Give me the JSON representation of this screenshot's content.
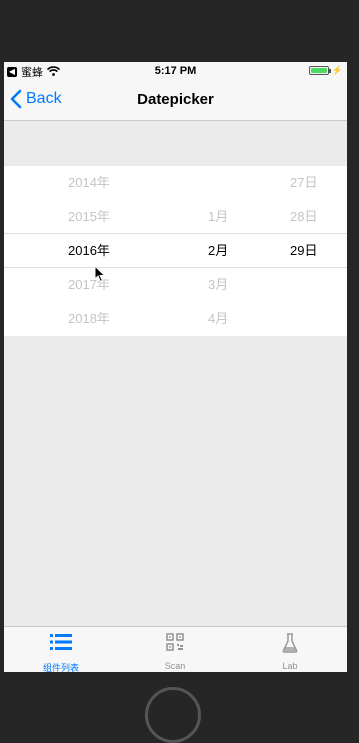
{
  "status_bar": {
    "carrier": "蜜蜂",
    "time": "5:17 PM",
    "battery_level": 1.0
  },
  "nav": {
    "back_label": "Back",
    "title": "Datepicker"
  },
  "picker": {
    "years": [
      "2014年",
      "2015年",
      "2016年",
      "2017年",
      "2018年"
    ],
    "months": [
      "1月",
      "2月",
      "3月",
      "4月"
    ],
    "days": [
      "27日",
      "28日",
      "29日"
    ],
    "selected": {
      "year": "2016年",
      "month": "2月",
      "day": "29日"
    }
  },
  "tabbar": {
    "items": [
      {
        "label": "组件列表",
        "icon": "list-icon",
        "active": true
      },
      {
        "label": "Scan",
        "icon": "qr-code-icon",
        "active": false
      },
      {
        "label": "Lab",
        "icon": "flask-icon",
        "active": false
      }
    ]
  },
  "colors": {
    "accent": "#007aff",
    "background": "#ebebeb",
    "battery": "#4cd964"
  }
}
